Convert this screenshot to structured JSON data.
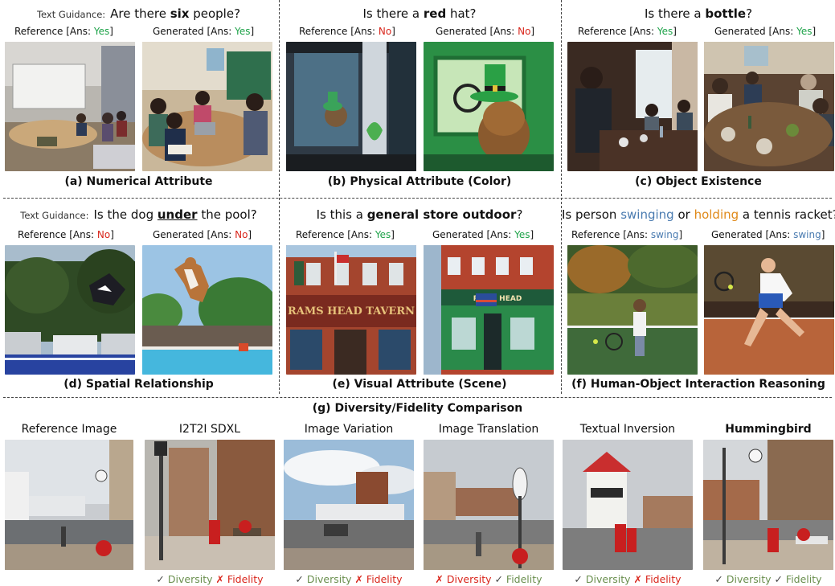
{
  "row1": {
    "a": {
      "prefix": "Text Guidance:",
      "q_pre": "Are there ",
      "q_bold": "six",
      "q_post": " people?",
      "ref_label": "Reference [Ans: ",
      "ref_ans": "Yes",
      "gen_label": "Generated [Ans: ",
      "gen_ans": "Yes",
      "close": "]",
      "caption": "(a)  Numerical Attribute"
    },
    "b": {
      "q_pre": "Is there a ",
      "q_bold": "red",
      "q_post": " hat?",
      "ref_label": "Reference [Ans: ",
      "ref_ans": "No",
      "gen_label": "Generated [Ans: ",
      "gen_ans": "No",
      "close": "]",
      "caption": "(b)  Physical Attribute (Color)"
    },
    "c": {
      "q_pre": "Is there a ",
      "q_bold": "bottle",
      "q_post": "?",
      "ref_label": "Reference [Ans: ",
      "ref_ans": "Yes",
      "gen_label": "Generated [Ans: ",
      "gen_ans": "Yes",
      "close": "]",
      "caption": "(c)  Object Existence"
    }
  },
  "row2": {
    "d": {
      "prefix": "Text Guidance:",
      "q_pre": "Is the dog ",
      "q_bold": "under",
      "q_post": " the pool?",
      "ref_label": "Reference [Ans: ",
      "ref_ans": "No",
      "gen_label": "Generated [Ans: ",
      "gen_ans": "No",
      "close": "]",
      "caption": "(d)  Spatial Relationship"
    },
    "e": {
      "q_pre": "Is this a ",
      "q_bold": "general store outdoor",
      "q_post": "?",
      "ref_label": "Reference [Ans: ",
      "ref_ans": "Yes",
      "gen_label": "Generated [Ans: ",
      "gen_ans": "Yes",
      "close": "]",
      "caption": "(e)  Visual Attribute (Scene)",
      "sign_text": "RAMS HEAD TAVERN",
      "sign_text_gen": "RAMS HEAD"
    },
    "f": {
      "q_pre": "Is person ",
      "q_swing": "swinging",
      "q_mid": " or ",
      "q_hold": "holding",
      "q_post": " a tennis racket?",
      "ref_label": "Reference [Ans: ",
      "ref_ans": "swing",
      "gen_label": "Generated [Ans: ",
      "gen_ans": "swing",
      "close": "]",
      "caption": "(f)  Human-Object Interaction Reasoning"
    }
  },
  "row3": {
    "title": "(g)  Diversity/Fidelity Comparison",
    "columns": [
      {
        "head": "Reference Image",
        "bold": false,
        "footer": null
      },
      {
        "head": "I2T2I SDXL",
        "bold": false,
        "footer": {
          "m1": "✓",
          "t1": " Diversity ",
          "m2": "✗",
          "t2": " Fidelity",
          "s1": "ok",
          "s2": "bad"
        }
      },
      {
        "head": "Image Variation",
        "bold": false,
        "footer": {
          "m1": "✓",
          "t1": " Diversity ",
          "m2": "✗",
          "t2": " Fidelity",
          "s1": "ok",
          "s2": "bad"
        }
      },
      {
        "head": "Image Translation",
        "bold": false,
        "footer": {
          "m1": "✗",
          "t1": " Diversity ",
          "m2": "✓",
          "t2": " Fidelity",
          "s1": "bad",
          "s2": "ok"
        }
      },
      {
        "head": "Textual Inversion",
        "bold": false,
        "footer": {
          "m1": "✓",
          "t1": " Diversity ",
          "m2": "✗",
          "t2": " Fidelity",
          "s1": "ok",
          "s2": "bad"
        }
      },
      {
        "head": "Hummingbird",
        "bold": true,
        "footer": {
          "m1": "✓",
          "t1": " Diversity ",
          "m2": "✓",
          "t2": " Fidelity",
          "s1": "ok",
          "s2": "ok"
        }
      }
    ]
  },
  "colors": {
    "yes": "#1fa34a",
    "no": "#d9261c",
    "swing": "#4a7bb0",
    "holding": "#e08a1a",
    "ok": "#6a8f4e"
  }
}
